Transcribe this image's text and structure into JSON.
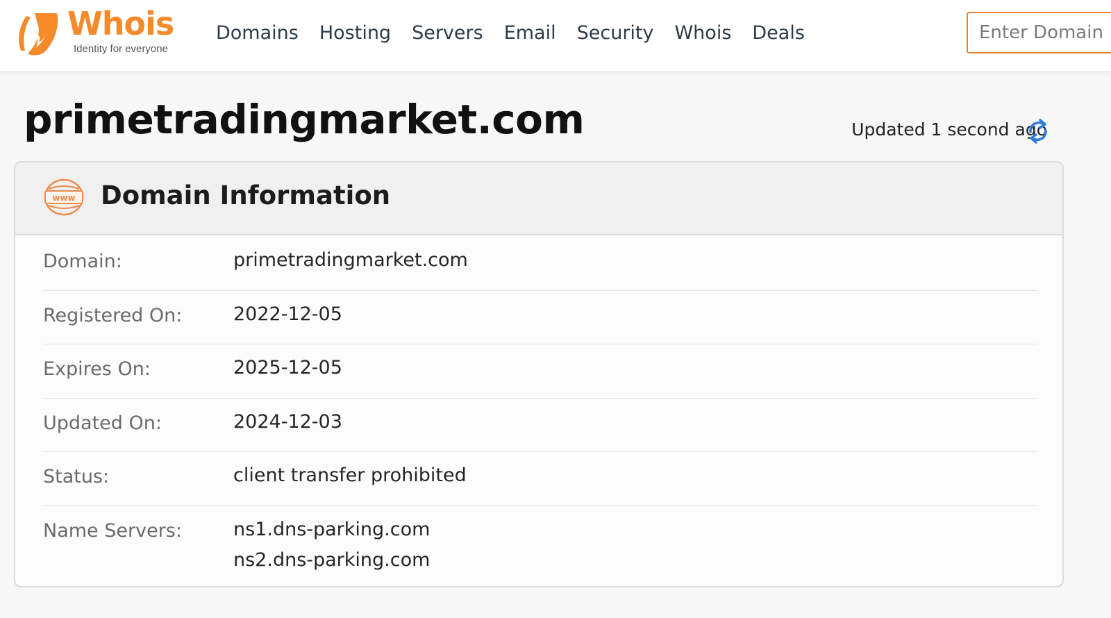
{
  "brand": {
    "name": "Whois",
    "tagline": "Identity for everyone",
    "color": "#f58a2a"
  },
  "nav": {
    "items": [
      "Domains",
      "Hosting",
      "Servers",
      "Email",
      "Security",
      "Whois",
      "Deals"
    ]
  },
  "search": {
    "placeholder": "Enter Domain"
  },
  "page": {
    "title": "primetradingmarket.com",
    "updated": "Updated 1 second ago"
  },
  "card": {
    "title": "Domain Information",
    "icon": "www-icon",
    "rows": [
      {
        "label": "Domain:",
        "values": [
          "primetradingmarket.com"
        ]
      },
      {
        "label": "Registered On:",
        "values": [
          "2022-12-05"
        ]
      },
      {
        "label": "Expires On:",
        "values": [
          "2025-12-05"
        ]
      },
      {
        "label": "Updated On:",
        "values": [
          "2024-12-03"
        ]
      },
      {
        "label": "Status:",
        "values": [
          "client transfer prohibited"
        ]
      },
      {
        "label": "Name Servers:",
        "values": [
          "ns1.dns-parking.com",
          "ns2.dns-parking.com"
        ]
      }
    ]
  },
  "colors": {
    "accent": "#f58a2a",
    "search_border": "#e4823a",
    "refresh": "#2f7fd6"
  }
}
